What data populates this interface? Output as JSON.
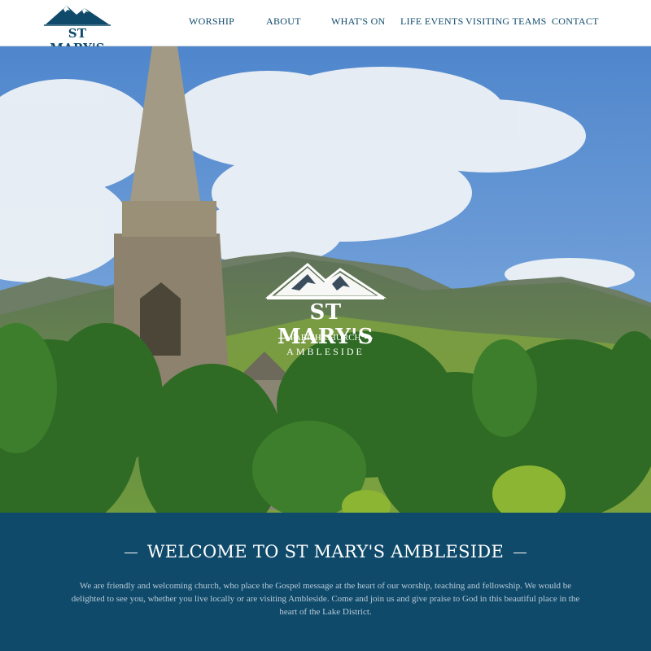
{
  "header": {
    "logo_text": "ST MARY'S",
    "nav": [
      {
        "label": "WORSHIP"
      },
      {
        "label": "ABOUT"
      },
      {
        "label": "WHAT'S ON"
      },
      {
        "label": "LIFE EVENTS"
      },
      {
        "label": "VISITING TEAMS"
      },
      {
        "label": "CONTACT"
      }
    ]
  },
  "hero": {
    "title": "ST MARY'S",
    "subtitle": "PARISH CHURCH",
    "place": "AMBLESIDE"
  },
  "welcome": {
    "title": "WELCOME TO ST MARY'S AMBLESIDE",
    "text": "We are friendly and welcoming church,  who place the Gospel message at the heart of our worship, teaching and fellowship. We would be delighted to see you, whether you live locally or are visiting Ambleside. Come and join us and give praise to God in this beautiful place in the heart of the Lake District."
  },
  "colors": {
    "brand": "#0f4a6b",
    "welcome_text": "#b9cad6",
    "sky": "#5b8fd0",
    "foliage": "#2f6b24"
  }
}
